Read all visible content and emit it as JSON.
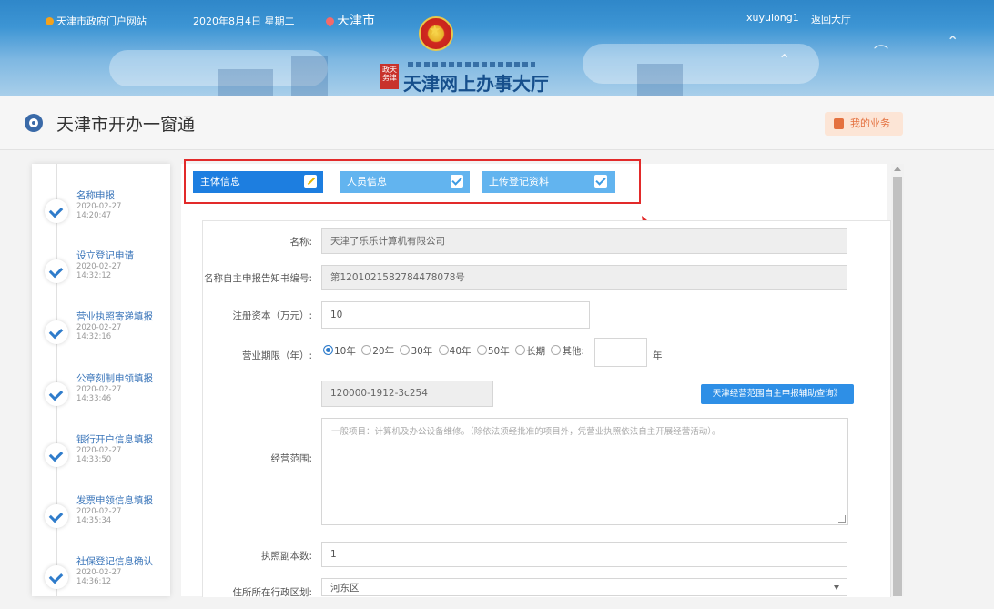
{
  "topbar": {
    "portal_link": "天津市政府门户网站",
    "date": "2020年8月4日 星期二",
    "city": "天津市",
    "username": "xuyulong1",
    "back_link": "返回大厅"
  },
  "header": {
    "site_name": "天津网上办事大厅",
    "logo_text": "政天 务津"
  },
  "page": {
    "title": "天津市开办一窗通",
    "my_business": "我的业务"
  },
  "steps": [
    {
      "label": "名称申报",
      "date": "2020-02-27",
      "time": "14:20:47"
    },
    {
      "label": "设立登记申请",
      "date": "2020-02-27",
      "time": "14:32:12"
    },
    {
      "label": "营业执照寄递填报",
      "date": "2020-02-27",
      "time": "14:32:16"
    },
    {
      "label": "公章刻制申领填报",
      "date": "2020-02-27",
      "time": "14:33:46"
    },
    {
      "label": "银行开户信息填报",
      "date": "2020-02-27",
      "time": "14:33:50"
    },
    {
      "label": "发票申领信息填报",
      "date": "2020-02-27",
      "time": "14:35:34"
    },
    {
      "label": "社保登记信息确认",
      "date": "2020-02-27",
      "time": "14:36:12"
    }
  ],
  "tabs": [
    {
      "label": "主体信息",
      "state": "editing"
    },
    {
      "label": "人员信息",
      "state": "done"
    },
    {
      "label": "上传登记资料",
      "state": "done"
    }
  ],
  "form": {
    "name_label": "名称:",
    "name_value": "天津了乐乐计算机有限公司",
    "notice_label": "名称自主申报告知书编号:",
    "notice_value": "第1201021582784478078号",
    "capital_label": "注册资本（万元）:",
    "capital_value": "10",
    "term_label": "营业期限（年）:",
    "term_options": [
      "10年",
      "20年",
      "30年",
      "40年",
      "50年",
      "长期",
      "其他:"
    ],
    "term_selected": "10年",
    "term_unit": "年",
    "scope_code": "120000-1912-3c254",
    "scope_query_button": "天津经营范围自主申报辅助查询》",
    "scope_label": "经营范围:",
    "scope_text": "一般项目：计算机及办公设备维修。（除依法须经批准的项目外，凭营业执照依法自主开展经营活动）。",
    "copies_label": "执照副本数:",
    "copies_value": "1",
    "district_label": "住所所在行政区划:",
    "district_value": "河东区"
  },
  "colors": {
    "tab_active": "#1d7ee0",
    "tab_inactive": "#62b4ef",
    "highlight": "#e22a2a",
    "accent": "#2f7ccb"
  }
}
